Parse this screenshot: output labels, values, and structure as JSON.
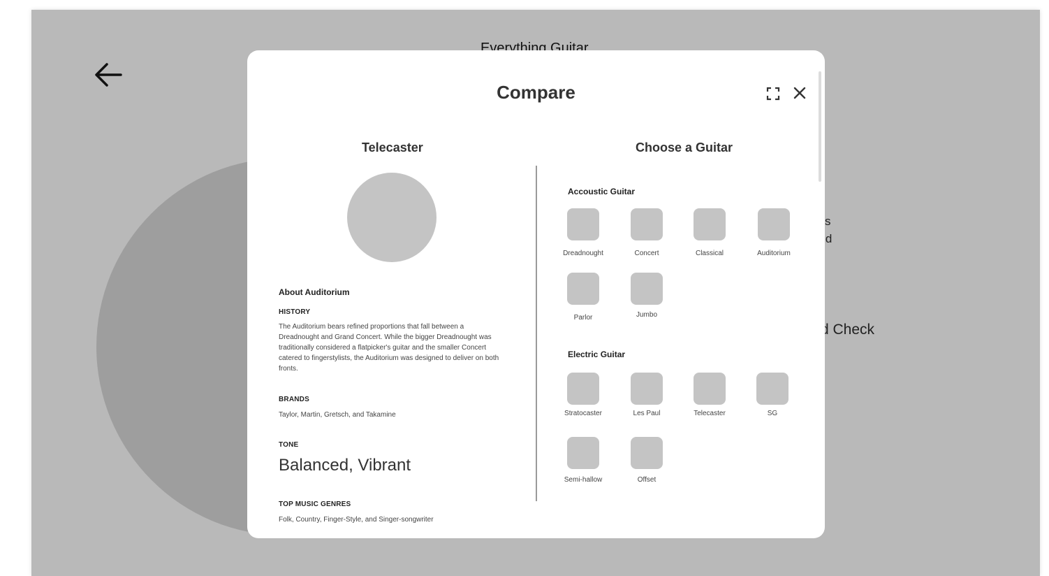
{
  "background": {
    "title": "Everything Guitar",
    "text_fragment": "ves\nand\ne",
    "heading_fragment": "d Check"
  },
  "modal": {
    "title": "Compare",
    "left": {
      "title": "Telecaster",
      "about": "About Auditorium",
      "history_label": "HISTORY",
      "history_text": "The Auditorium bears refined proportions that fall between a Dreadnought and Grand Concert. While the bigger Dreadnought was traditionally considered a flatpicker's guitar and the smaller Concert catered to fingerstylists, the Auditorium was designed to deliver on both fronts.",
      "brands_label": "BRANDS",
      "brands_text": "Taylor, Martin, Gretsch, and Takamine",
      "tone_label": "TONE",
      "tone_value": "Balanced, Vibrant",
      "genres_label": "TOP MUSIC GENRES",
      "genres_text": "Folk, Country, Finger-Style, and Singer-songwriter"
    },
    "right": {
      "title": "Choose a Guitar",
      "acoustic_label": "Accoustic Guitar",
      "acoustic": [
        "Dreadnought",
        "Concert",
        "Classical",
        "Auditorium",
        "Parlor",
        "Jumbo"
      ],
      "electric_label": "Electric Guitar",
      "electric": [
        "Stratocaster",
        "Les Paul",
        "Telecaster",
        "SG",
        "Semi-hallow",
        "Offset"
      ]
    }
  },
  "icons": {
    "back": "arrow-left-icon",
    "expand": "expand-icon",
    "close": "close-icon"
  },
  "colors": {
    "backdrop": "#b9b9b9",
    "placeholder": "#c4c4c4",
    "bg_circle": "#9e9e9e"
  }
}
